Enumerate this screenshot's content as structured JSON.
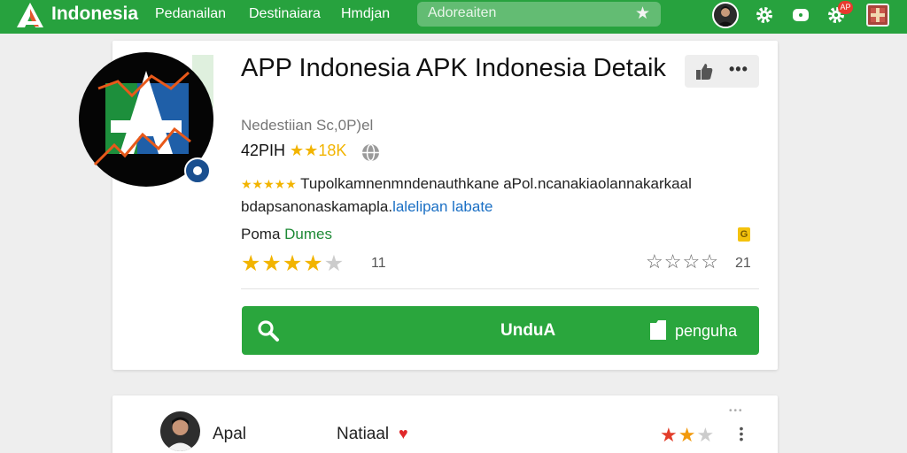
{
  "colors": {
    "topbar": "#27a23e",
    "install_button": "#2aa63d",
    "star_gold": "#f2b400",
    "link_blue": "#1a6fc4"
  },
  "header": {
    "brand": "Indonesia",
    "nav": [
      "Pedanailan",
      "Destinaiara",
      "Hmdjan"
    ],
    "search": {
      "value": "Adoreaiten",
      "icon": "star-icon"
    },
    "icons": [
      "user-avatar",
      "settings-icon",
      "message-icon",
      "gear-icon",
      "gift-icon"
    ],
    "notification_badge": "AP"
  },
  "app": {
    "title": "APP Indonesia APK Indonesia Detaik",
    "developer": "Nedestiian Sc,0P)el",
    "size_text": "42PIH",
    "rating_text": "★★18K",
    "description_stars": "★★★★★",
    "description_text": " Tupolkamnenmndenauthkane aPol.ncanakiaolannakarkaal bdapsanonaskamapla.",
    "description_link": "lalelipan labate",
    "genre_prefix": "Poma",
    "genre": "Dumes",
    "badge": "G",
    "rating_left": {
      "value": 4,
      "max": 5,
      "count": "11"
    },
    "rating_right": {
      "count": "21"
    },
    "install_label": "UnduA",
    "secondary_label": "penguha",
    "actions": [
      "thumbs-up-icon",
      "more-icon"
    ]
  },
  "review": {
    "author": "Apal",
    "title": "Natiaal",
    "rating": {
      "value": 2,
      "max": 3
    }
  }
}
